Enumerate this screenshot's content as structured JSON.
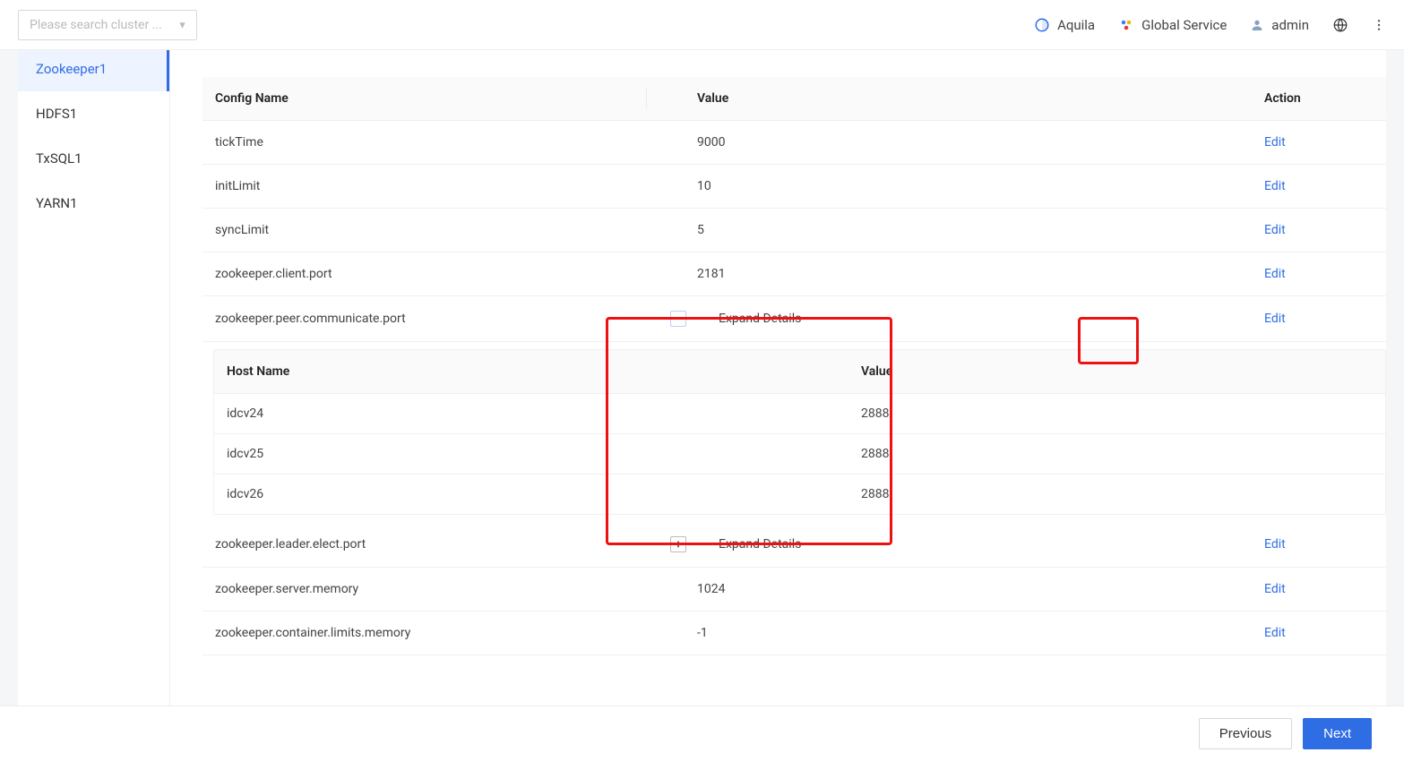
{
  "header": {
    "search_placeholder": "Please search cluster ...",
    "aquila_label": "Aquila",
    "global_service_label": "Global Service",
    "admin_label": "admin"
  },
  "sidebar": {
    "items": [
      {
        "label": "Zookeeper1",
        "active": true
      },
      {
        "label": "HDFS1",
        "active": false
      },
      {
        "label": "TxSQL1",
        "active": false
      },
      {
        "label": "YARN1",
        "active": false
      }
    ]
  },
  "table": {
    "header": {
      "name": "Config Name",
      "value": "Value",
      "action": "Action"
    },
    "edit_label": "Edit",
    "expand_label": "Expand Details",
    "rows": [
      {
        "name": "tickTime",
        "value": "9000"
      },
      {
        "name": "initLimit",
        "value": "10"
      },
      {
        "name": "syncLimit",
        "value": "5"
      },
      {
        "name": "zookeeper.client.port",
        "value": "2181"
      },
      {
        "name": "zookeeper.peer.communicate.port",
        "value": "",
        "expanded": true
      },
      {
        "name": "zookeeper.leader.elect.port",
        "value": "",
        "expanded": false
      },
      {
        "name": "zookeeper.server.memory",
        "value": "1024"
      },
      {
        "name": "zookeeper.container.limits.memory",
        "value": "-1"
      }
    ],
    "host_table": {
      "header": {
        "name": "Host Name",
        "value": "Value"
      },
      "rows": [
        {
          "name": "idcv24",
          "value": "2888"
        },
        {
          "name": "idcv25",
          "value": "2888"
        },
        {
          "name": "idcv26",
          "value": "2888"
        }
      ]
    }
  },
  "footer": {
    "previous": "Previous",
    "next": "Next"
  }
}
